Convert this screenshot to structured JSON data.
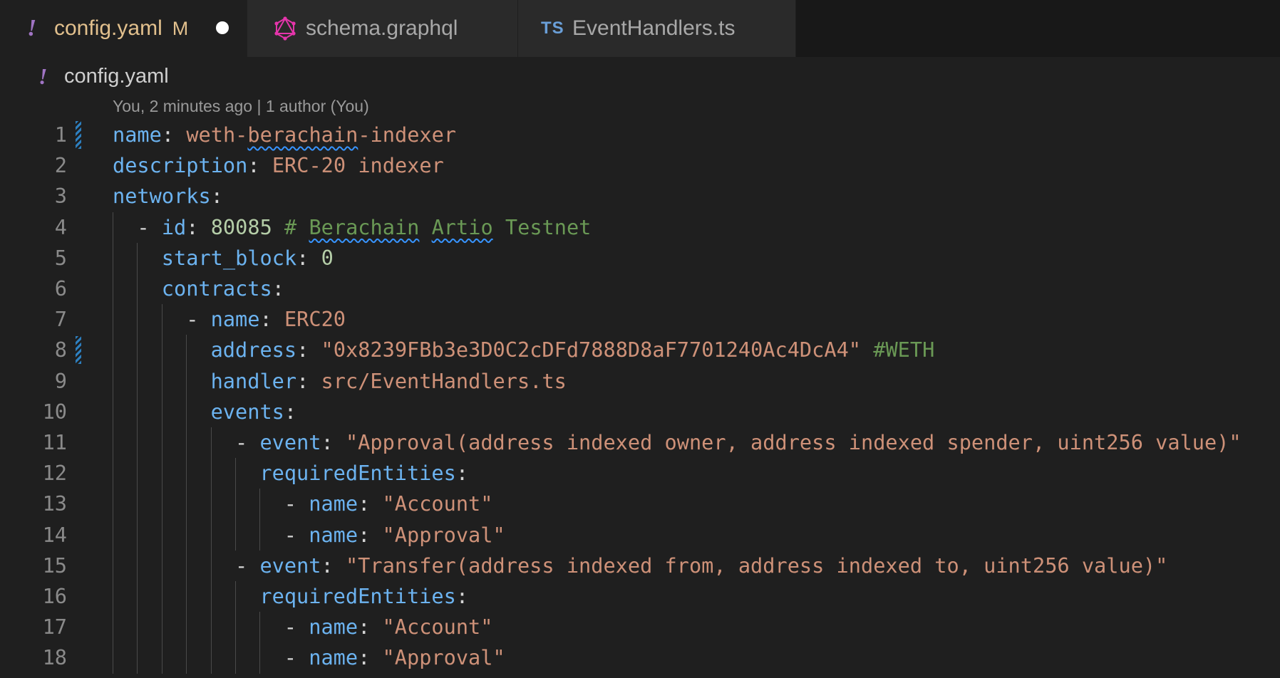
{
  "tabs": [
    {
      "name": "config.yaml",
      "badge": "M",
      "active": true
    },
    {
      "name": "schema.graphql",
      "active": false
    },
    {
      "name": "EventHandlers.ts",
      "icon_text": "TS",
      "active": false
    }
  ],
  "breadcrumb": {
    "file": "config.yaml",
    "icon": "yaml-exclamation-icon"
  },
  "blame": "You, 2 minutes ago | 1 author (You)",
  "colors": {
    "key": "#6cb3f0",
    "string": "#ce9178",
    "number": "#b5cea8",
    "comment": "#6a9955",
    "line_number": "#8a8a8a",
    "modified": "#e2c08d"
  },
  "editor": {
    "lines": [
      {
        "n": "1",
        "indent": 0,
        "modified": true,
        "tokens": [
          [
            "k",
            "name"
          ],
          [
            "p",
            ": "
          ],
          [
            "s",
            "weth-"
          ],
          [
            "s",
            "berachain",
            "sq"
          ],
          [
            "s",
            "-indexer"
          ]
        ]
      },
      {
        "n": "2",
        "indent": 0,
        "tokens": [
          [
            "k",
            "description"
          ],
          [
            "p",
            ": "
          ],
          [
            "s",
            "ERC-20 indexer"
          ]
        ]
      },
      {
        "n": "3",
        "indent": 0,
        "tokens": [
          [
            "k",
            "networks"
          ],
          [
            "p",
            ":"
          ]
        ]
      },
      {
        "n": "4",
        "indent": 1,
        "tokens": [
          [
            "p",
            "- "
          ],
          [
            "k",
            "id"
          ],
          [
            "p",
            ": "
          ],
          [
            "n",
            "80085"
          ],
          [
            "c",
            " # "
          ],
          [
            "c",
            "Berachain",
            "sq"
          ],
          [
            "c",
            " "
          ],
          [
            "c",
            "Artio",
            "sq"
          ],
          [
            "c",
            " Testnet"
          ]
        ]
      },
      {
        "n": "5",
        "indent": 2,
        "tokens": [
          [
            "k",
            "start_block"
          ],
          [
            "p",
            ": "
          ],
          [
            "n",
            "0"
          ]
        ]
      },
      {
        "n": "6",
        "indent": 2,
        "tokens": [
          [
            "k",
            "contracts"
          ],
          [
            "p",
            ":"
          ]
        ]
      },
      {
        "n": "7",
        "indent": 3,
        "tokens": [
          [
            "p",
            "- "
          ],
          [
            "k",
            "name"
          ],
          [
            "p",
            ": "
          ],
          [
            "s",
            "ERC20"
          ]
        ]
      },
      {
        "n": "8",
        "indent": 4,
        "modified": true,
        "tokens": [
          [
            "k",
            "address"
          ],
          [
            "p",
            ": "
          ],
          [
            "s",
            "\"0x8239FBb3e3D0C2cDFd7888D8aF7701240Ac4DcA4\""
          ],
          [
            "c",
            " #WETH"
          ]
        ]
      },
      {
        "n": "9",
        "indent": 4,
        "tokens": [
          [
            "k",
            "handler"
          ],
          [
            "p",
            ": "
          ],
          [
            "s",
            "src/EventHandlers.ts"
          ]
        ]
      },
      {
        "n": "10",
        "indent": 4,
        "tokens": [
          [
            "k",
            "events"
          ],
          [
            "p",
            ":"
          ]
        ]
      },
      {
        "n": "11",
        "indent": 5,
        "tokens": [
          [
            "p",
            "- "
          ],
          [
            "k",
            "event"
          ],
          [
            "p",
            ": "
          ],
          [
            "s",
            "\"Approval(address indexed owner, address indexed spender, uint256 value)\""
          ]
        ]
      },
      {
        "n": "12",
        "indent": 6,
        "tokens": [
          [
            "k",
            "requiredEntities"
          ],
          [
            "p",
            ":"
          ]
        ]
      },
      {
        "n": "13",
        "indent": 7,
        "tokens": [
          [
            "p",
            "- "
          ],
          [
            "k",
            "name"
          ],
          [
            "p",
            ": "
          ],
          [
            "s",
            "\"Account\""
          ]
        ]
      },
      {
        "n": "14",
        "indent": 7,
        "tokens": [
          [
            "p",
            "- "
          ],
          [
            "k",
            "name"
          ],
          [
            "p",
            ": "
          ],
          [
            "s",
            "\"Approval\""
          ]
        ]
      },
      {
        "n": "15",
        "indent": 5,
        "tokens": [
          [
            "p",
            "- "
          ],
          [
            "k",
            "event"
          ],
          [
            "p",
            ": "
          ],
          [
            "s",
            "\"Transfer(address indexed from, address indexed to, uint256 value)\""
          ]
        ]
      },
      {
        "n": "16",
        "indent": 6,
        "tokens": [
          [
            "k",
            "requiredEntities"
          ],
          [
            "p",
            ":"
          ]
        ]
      },
      {
        "n": "17",
        "indent": 7,
        "tokens": [
          [
            "p",
            "- "
          ],
          [
            "k",
            "name"
          ],
          [
            "p",
            ": "
          ],
          [
            "s",
            "\"Account\""
          ]
        ]
      },
      {
        "n": "18",
        "indent": 7,
        "tokens": [
          [
            "p",
            "- "
          ],
          [
            "k",
            "name"
          ],
          [
            "p",
            ": "
          ],
          [
            "s",
            "\"Approval\""
          ]
        ]
      }
    ]
  }
}
